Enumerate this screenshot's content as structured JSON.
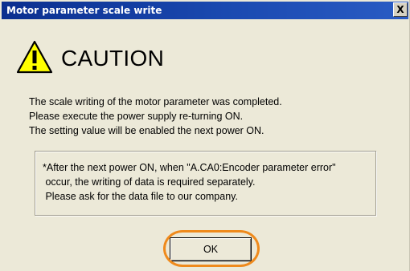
{
  "window": {
    "title": "Motor parameter scale write",
    "close_label": "X"
  },
  "heading": {
    "icon": "warning-icon",
    "text": "CAUTION"
  },
  "message": {
    "lines": [
      "The scale writing of the motor parameter was completed.",
      "Please execute the power supply re-turning ON.",
      "The setting value will be enabled the next power ON."
    ]
  },
  "note": {
    "lines": [
      "*After the next power ON, when \"A.CA0:Encoder parameter error\"",
      " occur, the writing of data is required separately.",
      " Please ask for the data file to our company."
    ]
  },
  "buttons": {
    "ok_label": "OK"
  },
  "colors": {
    "titlebar": "#0b2f8f",
    "dialog_bg": "#ece9d8",
    "warning_fill": "#ffff00",
    "highlight": "#ef8a1c"
  }
}
